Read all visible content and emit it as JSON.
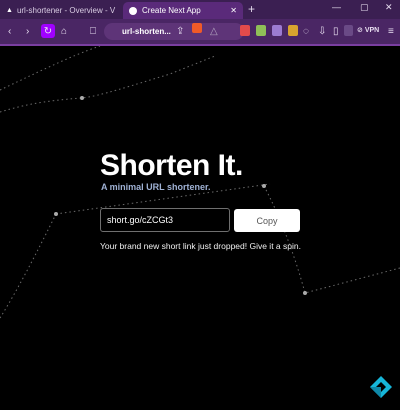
{
  "browser": {
    "tabs": [
      {
        "label": "url-shortener - Overview - V",
        "active": false
      },
      {
        "label": "Create Next App",
        "active": true
      }
    ],
    "address": "url-shorten...",
    "vpn_label": "VPN",
    "accent": "#7a3ea0"
  },
  "hero": {
    "title": "Shorten It.",
    "subtitle": "A minimal URL shortener."
  },
  "form": {
    "short_url_value": "short.go/cZCGt3",
    "copy_label": "Copy"
  },
  "message": "Your brand new short link just dropped! Give it a spin."
}
